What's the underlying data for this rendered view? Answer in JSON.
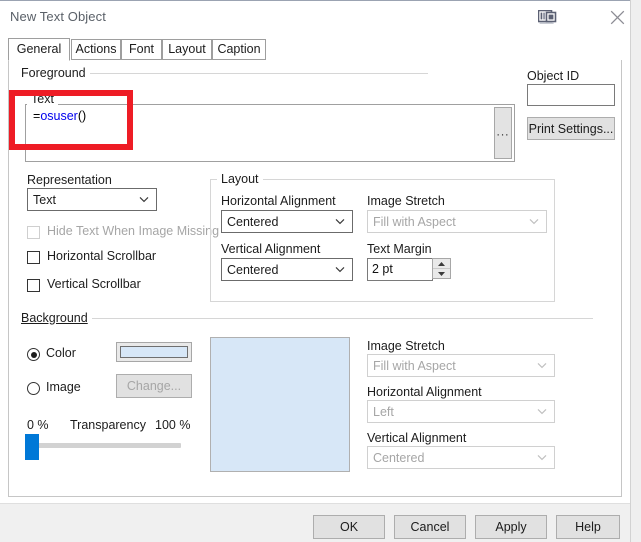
{
  "window": {
    "title": "New Text Object",
    "dock_icon": "dock-panel-icon",
    "close_icon": "close-icon"
  },
  "tabs": [
    {
      "label": "General",
      "active": true
    },
    {
      "label": "Actions",
      "active": false
    },
    {
      "label": "Font",
      "active": false
    },
    {
      "label": "Layout",
      "active": false
    },
    {
      "label": "Caption",
      "active": false
    }
  ],
  "foreground": {
    "group_label": "Foreground",
    "text_group_label": "Text",
    "text_value_prefix": "=",
    "text_value_fn": "osuser",
    "text_value_suffix": "()",
    "ellipsis_button_label": "...",
    "object_id_label": "Object ID",
    "object_id_value": "",
    "print_settings_label": "Print Settings..."
  },
  "representation": {
    "group_label": "Representation",
    "combo_value": "Text",
    "hide_text_label": "Hide Text When Image Missing",
    "hide_text_checked": false,
    "hide_text_disabled": true,
    "horizontal_scrollbar_label": "Horizontal Scrollbar",
    "horizontal_scrollbar_checked": false,
    "vertical_scrollbar_label": "Vertical Scrollbar",
    "vertical_scrollbar_checked": false
  },
  "layout": {
    "group_label": "Layout",
    "horizontal_alignment_label": "Horizontal Alignment",
    "horizontal_alignment_value": "Centered",
    "vertical_alignment_label": "Vertical Alignment",
    "vertical_alignment_value": "Centered",
    "image_stretch_label": "Image Stretch",
    "image_stretch_value": "Fill with Aspect",
    "image_stretch_disabled": true,
    "text_margin_label": "Text Margin",
    "text_margin_value": "2 pt"
  },
  "background": {
    "group_label": "Background",
    "color_radio_label": "Color",
    "color_radio_selected": true,
    "image_radio_label": "Image",
    "image_radio_selected": false,
    "change_button_label": "Change...",
    "change_button_disabled": true,
    "swatch_color": "#d7e7f7",
    "preview_color": "#d7e7f7",
    "transparency_label": "Transparency",
    "transparency_min_label": "0 %",
    "transparency_max_label": "100 %",
    "transparency_value": 0,
    "image_stretch_label": "Image Stretch",
    "image_stretch_value": "Fill with Aspect",
    "horizontal_alignment_label": "Horizontal Alignment",
    "horizontal_alignment_value": "Left",
    "vertical_alignment_label": "Vertical Alignment",
    "vertical_alignment_value": "Centered"
  },
  "footer": {
    "ok_label": "OK",
    "cancel_label": "Cancel",
    "apply_label": "Apply",
    "help_label": "Help"
  },
  "annotation": {
    "color": "#ee1c25"
  }
}
